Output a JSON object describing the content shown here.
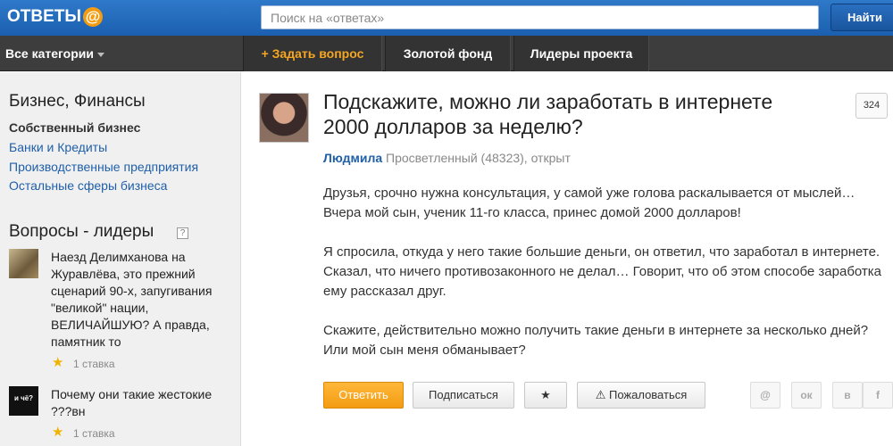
{
  "header": {
    "logo_text": "ОТВЕТЫ",
    "logo_symbol": "@",
    "search_placeholder": "Поиск на «ответах»",
    "search_button": "Найти"
  },
  "nav": {
    "categories": "Все категории",
    "items": [
      "+ Задать вопрос",
      "Золотой фонд",
      "Лидеры проекта"
    ],
    "accent_color": "#f5a623"
  },
  "sidebar": {
    "section_title": "Бизнес, Финансы",
    "active_item": "Собственный бизнес",
    "links": [
      "Банки и Кредиты",
      "Производственные предприятия",
      "Остальные сферы бизнеса"
    ],
    "leaders_title": "Вопросы - лидеры",
    "help_symbol": "?",
    "leaders": [
      {
        "text": "Наезд Делимханова на Журавлёва, это прежний сценарий 90-х, запугивания \"великой\" нации, ВЕЛИЧАЙШУЮ? А правда, памятник то",
        "stakes": "1 ставка"
      },
      {
        "text": "Почему они такие жестокие ???вн",
        "stakes": "1 ставка",
        "thumb_text": "и чё?"
      }
    ]
  },
  "question": {
    "title": "Подскажите, можно ли заработать в интернете 2000 долларов за неделю?",
    "views": "324",
    "author": "Людмила",
    "author_meta": "Просветленный (48323), открыт",
    "body": [
      "Друзья, срочно нужна консультация, у самой уже голова раскалывается от мыслей… Вчера мой сын, ученик 11-го класса, принес домой 2000 долларов!",
      "Я спросила, откуда у него такие большие деньги, он ответил, что заработал в интернете. Сказал, что ничего противозаконного не делал… Говорит, что об этом способе заработка ему рассказал друг.",
      "Скажите, действительно можно получить такие деньги в интернете за несколько дней? Или мой сын меня обманывает?"
    ]
  },
  "actions": {
    "answer": "Ответить",
    "subscribe": "Подписаться",
    "star": "★",
    "report": "⚠ Пожаловаться",
    "share": [
      "@",
      "ок",
      "в",
      "f"
    ]
  }
}
